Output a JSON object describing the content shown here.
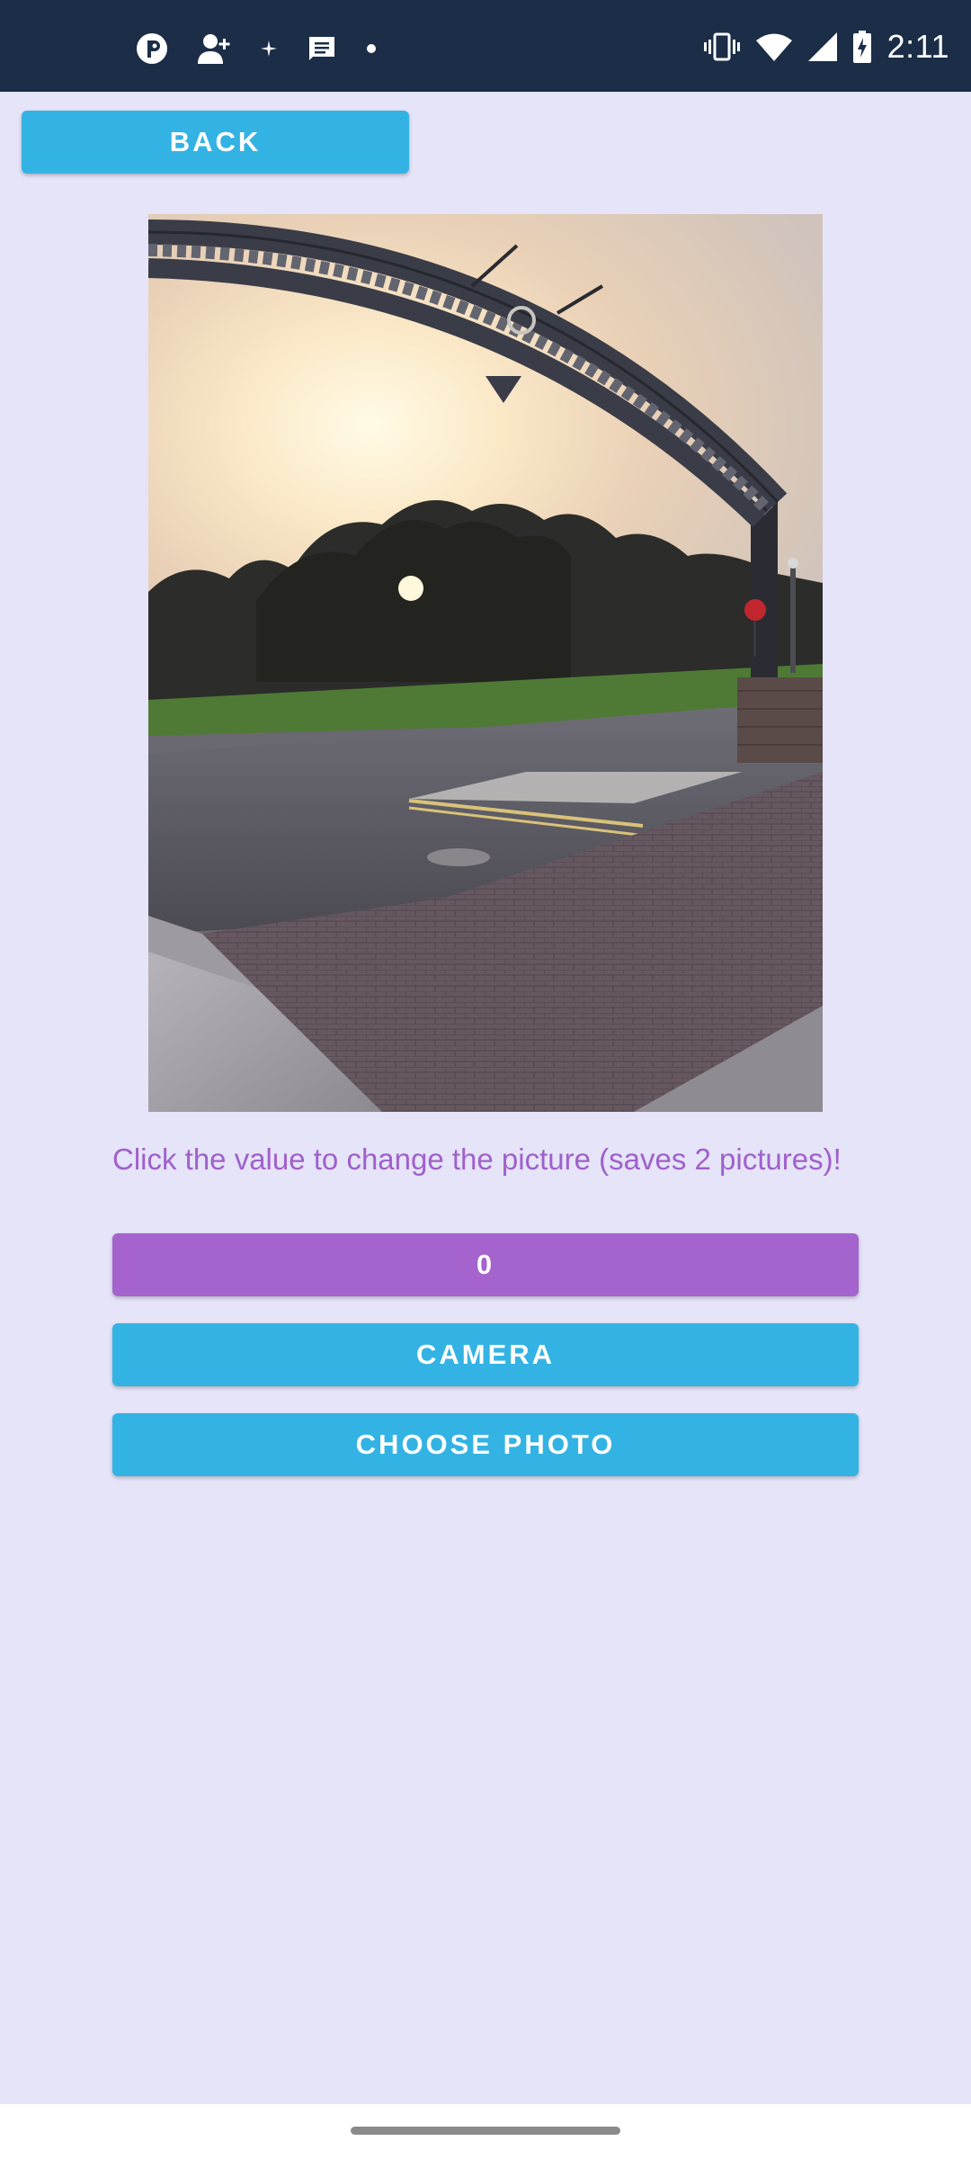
{
  "status_bar": {
    "time": "2:11",
    "left_icons": [
      "p-circle-icon",
      "person-add-icon",
      "sparkle-icon",
      "message-icon",
      "dot-icon"
    ],
    "right_icons": [
      "vibrate-icon",
      "wifi-icon",
      "signal-icon",
      "battery-charging-icon"
    ],
    "background": "#1b2d47"
  },
  "toolbar": {
    "back_label": "BACK"
  },
  "photo": {
    "subject": "street-arch-sunset-photo"
  },
  "hint": {
    "text": "Click the value to change the picture (saves 2 pictures)!",
    "color": "#a060cc"
  },
  "actions": {
    "value_label": "0",
    "camera_label": "CAMERA",
    "choose_photo_label": "CHOOSE PHOTO"
  },
  "colors": {
    "accent_blue": "#33b3e3",
    "accent_purple": "#a563cd",
    "background": "#e5e4f8"
  }
}
